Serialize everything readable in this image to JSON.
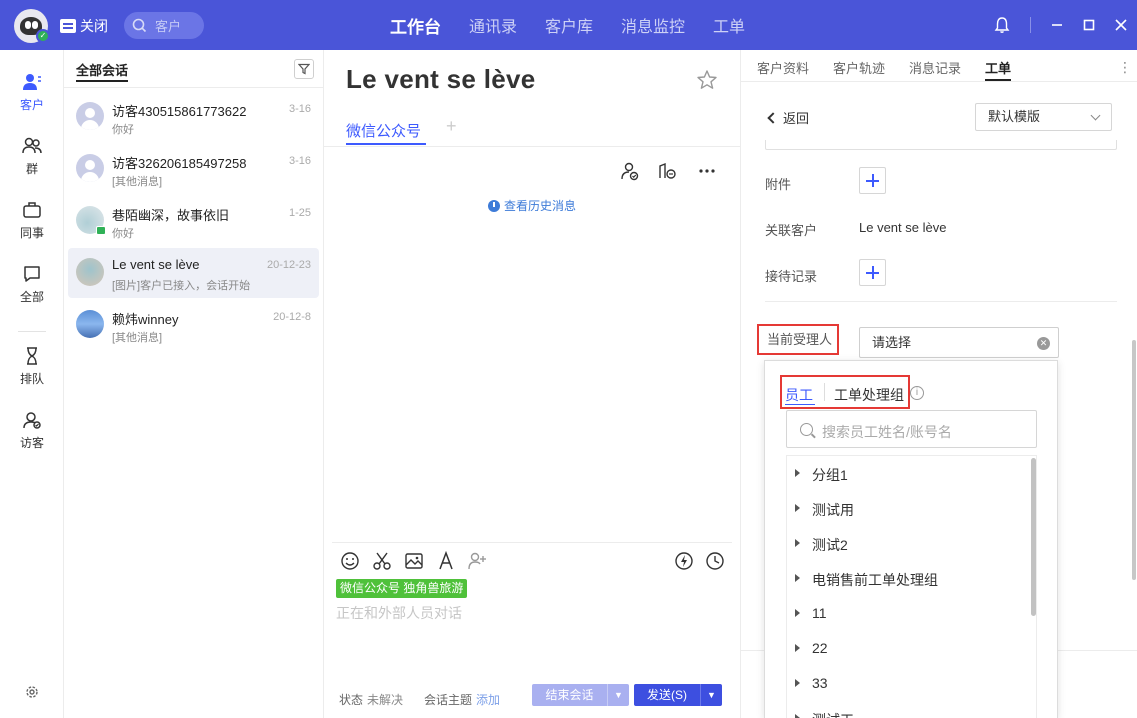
{
  "topbar": {
    "close_label": "关闭",
    "search_placeholder": "客户",
    "nav": [
      "工作台",
      "通讯录",
      "客户库",
      "消息监控",
      "工单"
    ],
    "accent": "#4a55d8"
  },
  "rail": {
    "items": [
      {
        "label": "客户",
        "icon": "customer-icon"
      },
      {
        "label": "群",
        "icon": "group-icon"
      },
      {
        "label": "同事",
        "icon": "briefcase-icon"
      },
      {
        "label": "全部",
        "icon": "chat-bubble-icon"
      },
      {
        "label": "排队",
        "icon": "hourglass-icon"
      },
      {
        "label": "访客",
        "icon": "visitor-icon"
      }
    ]
  },
  "convlist": {
    "header": "全部会话",
    "items": [
      {
        "name": "访客430515861773622",
        "preview": "你好",
        "time": "3-16"
      },
      {
        "name": "访客326206185497258",
        "preview": "[其他消息]",
        "time": "3-16"
      },
      {
        "name": "巷陌幽深，故事依旧",
        "preview": "你好",
        "time": "1-25"
      },
      {
        "name": "Le vent se lève",
        "preview": "[图片]客户已接入，会话开始",
        "time": "20-12-23"
      },
      {
        "name": "赖炜winney",
        "preview": "[其他消息]",
        "time": "20-12-8"
      }
    ]
  },
  "chat": {
    "title": "Le vent se lève",
    "tab": "微信公众号",
    "tab_add": "+",
    "history_link": "查看历史消息",
    "channel_badge": "微信公众号 独角兽旅游",
    "composer_placeholder": "正在和外部人员对话",
    "status_label": "状态",
    "status_value": "未解决",
    "topic_label": "会话主题",
    "topic_add": "添加",
    "end_button": "结束会话",
    "send_button": "发送(S)"
  },
  "rpanel": {
    "tabs": [
      "客户资料",
      "客户轨迹",
      "消息记录",
      "工单"
    ],
    "back": "返回",
    "template": "默认模版",
    "fields": {
      "attachment": "附件",
      "related_customer": "关联客户",
      "related_customer_value": "Le vent se lève",
      "reception_record": "接待记录",
      "assignee": "当前受理人",
      "assignee_placeholder": "请选择"
    }
  },
  "dropdown": {
    "tab_staff": "员工",
    "tab_group": "工单处理组",
    "search_placeholder": "搜索员工姓名/账号名",
    "groups": [
      "分组1",
      "测试用",
      "测试2",
      "电销售前工单处理组",
      "11",
      "22",
      "33",
      "测试工"
    ]
  }
}
